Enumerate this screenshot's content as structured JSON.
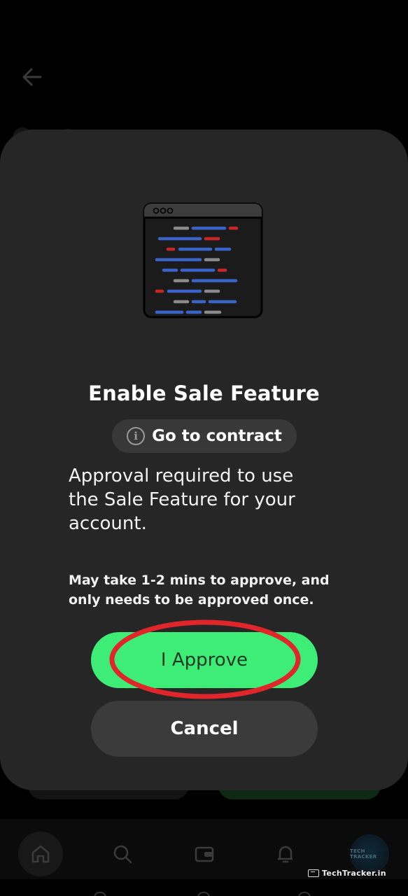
{
  "modal": {
    "title": "Enable Sale Feature",
    "contract_link": "Go to contract",
    "info_symbol": "i",
    "description": "Approval required to use the Sale Feature for your account.",
    "note": "May take 1-2 mins to approve, and only needs to be approved once.",
    "approve_label": "I Approve",
    "cancel_label": "Cancel"
  },
  "annotation": {
    "highlight_color": "#e0252b"
  },
  "bottom_nav": {
    "items": [
      "home-icon",
      "search-icon",
      "wallet-icon",
      "bell-icon",
      "profile-avatar"
    ],
    "profile_avatar_text": "TECH TRACKER"
  },
  "watermark": {
    "text": "TechTracker.in"
  },
  "colors": {
    "approve_bg": "#3ded76",
    "modal_bg": "#262626",
    "cancel_bg": "#3b3b3b"
  }
}
